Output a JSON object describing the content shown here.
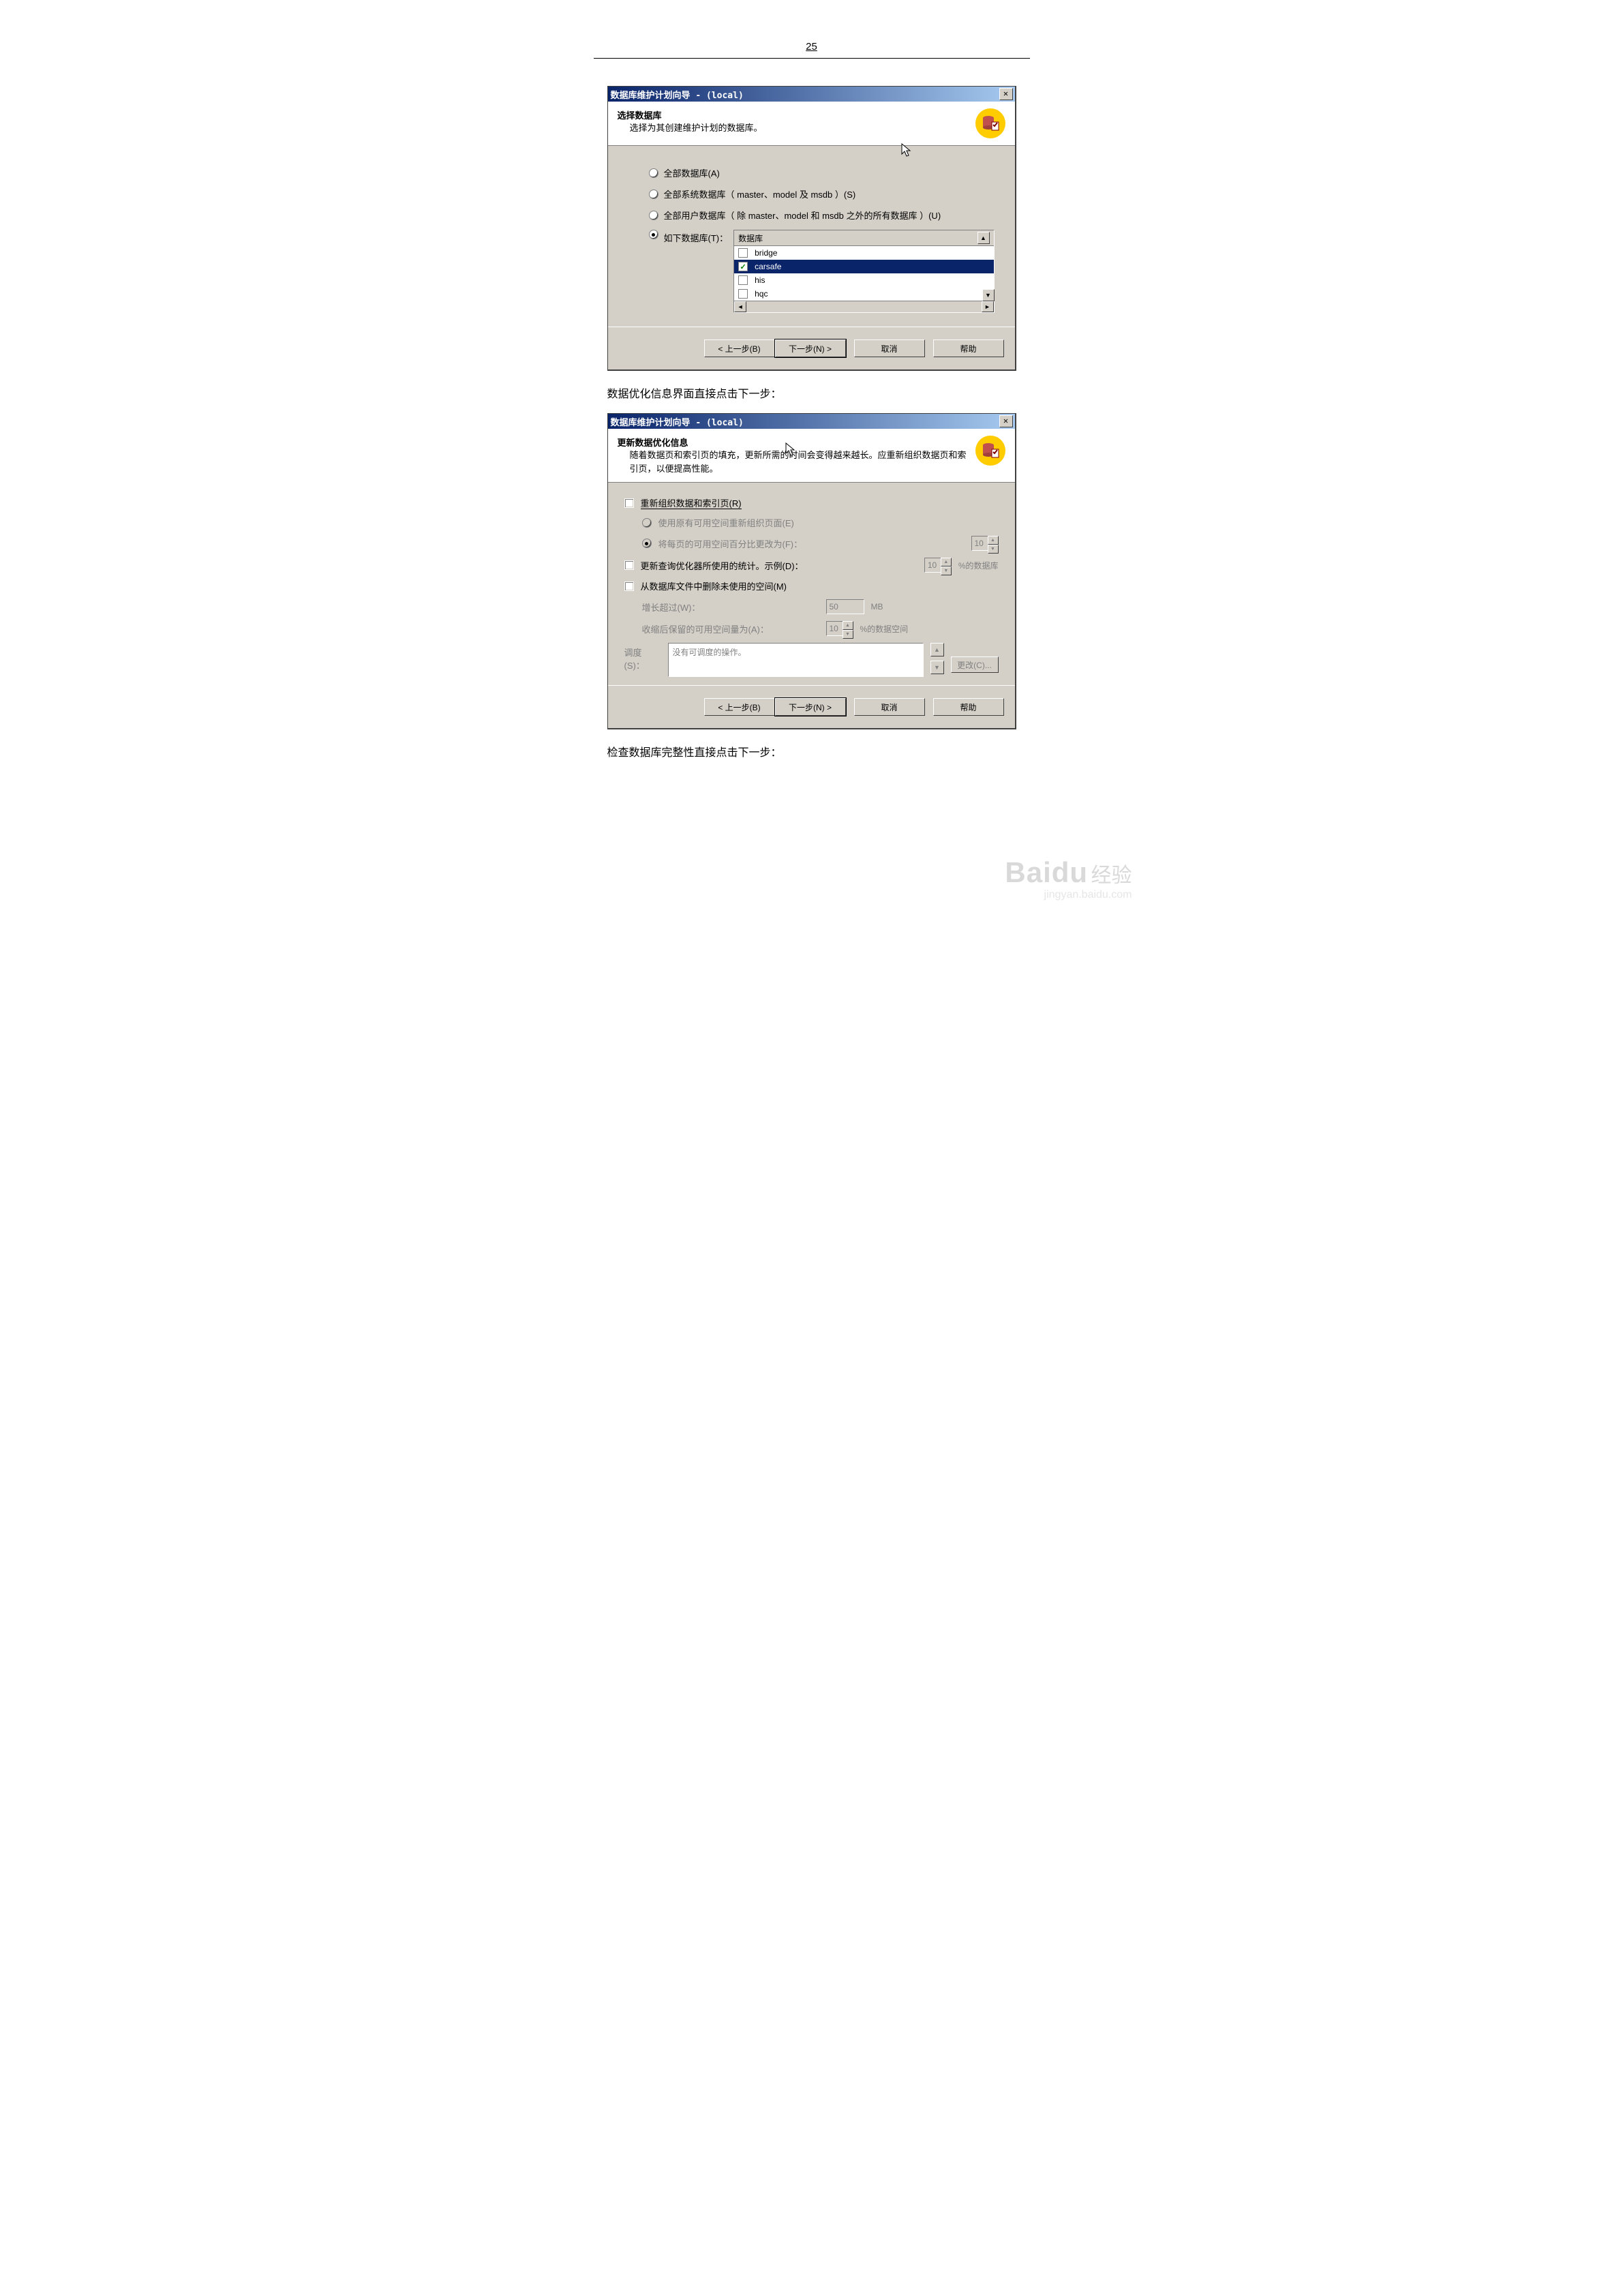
{
  "page_number": "25",
  "caption1": "数据优化信息界面直接点击下一步：",
  "caption2": "检查数据库完整性直接点击下一步：",
  "dialog1": {
    "title": "数据库维护计划向导 - (local)",
    "header_title": "选择数据库",
    "header_desc": "选择为其创建维护计划的数据库。",
    "radio_all": "全部数据库(A)",
    "radio_sys": "全部系统数据库（ master、model 及 msdb ）(S)",
    "radio_user": "全部用户数据库（ 除 master、model 和 msdb 之外的所有数据库 ）(U)",
    "radio_these": "如下数据库(T)：",
    "col_header": "数据库",
    "rows": [
      {
        "name": "bridge",
        "checked": false,
        "selected": false
      },
      {
        "name": "carsafe",
        "checked": true,
        "selected": true
      },
      {
        "name": "his",
        "checked": false,
        "selected": false
      },
      {
        "name": "hqc",
        "checked": false,
        "selected": false
      }
    ],
    "btn_back": "< 上一步(B)",
    "btn_next": "下一步(N) >",
    "btn_cancel": "取消",
    "btn_help": "帮助"
  },
  "dialog2": {
    "title": "数据库维护计划向导 - (local)",
    "header_title": "更新数据优化信息",
    "header_desc": "随着数据页和索引页的填充，更新所需的时间会变得越来越长。应重新组织数据页和索引页，以便提高性能。",
    "chk_reorg": "重新组织数据和索引页(R)",
    "rad_existing": "使用原有可用空间重新组织页面(E)",
    "rad_change_pct": "将每页的可用空间百分比更改为(F)：",
    "pct_value": "10",
    "chk_update_stats": "更新查询优化器所使用的统计。示例(D)：",
    "stats_value": "10",
    "stats_unit": "%的数据库",
    "chk_remove_space": "从数据库文件中删除未使用的空间(M)",
    "grow_label": "增长超过(W)：",
    "grow_value": "50",
    "grow_unit": "MB",
    "shrink_label": "收缩后保留的可用空间量为(A)：",
    "shrink_value": "10",
    "shrink_unit": "%的数据空间",
    "sched_label": "调度(S)：",
    "sched_text": "没有可调度的操作。",
    "change_btn": "更改(C)...",
    "btn_back": "< 上一步(B)",
    "btn_next": "下一步(N) >",
    "btn_cancel": "取消",
    "btn_help": "帮助"
  },
  "watermark": {
    "brand": "Baidu",
    "cn": "经验",
    "url": "jingyan.baidu.com"
  }
}
